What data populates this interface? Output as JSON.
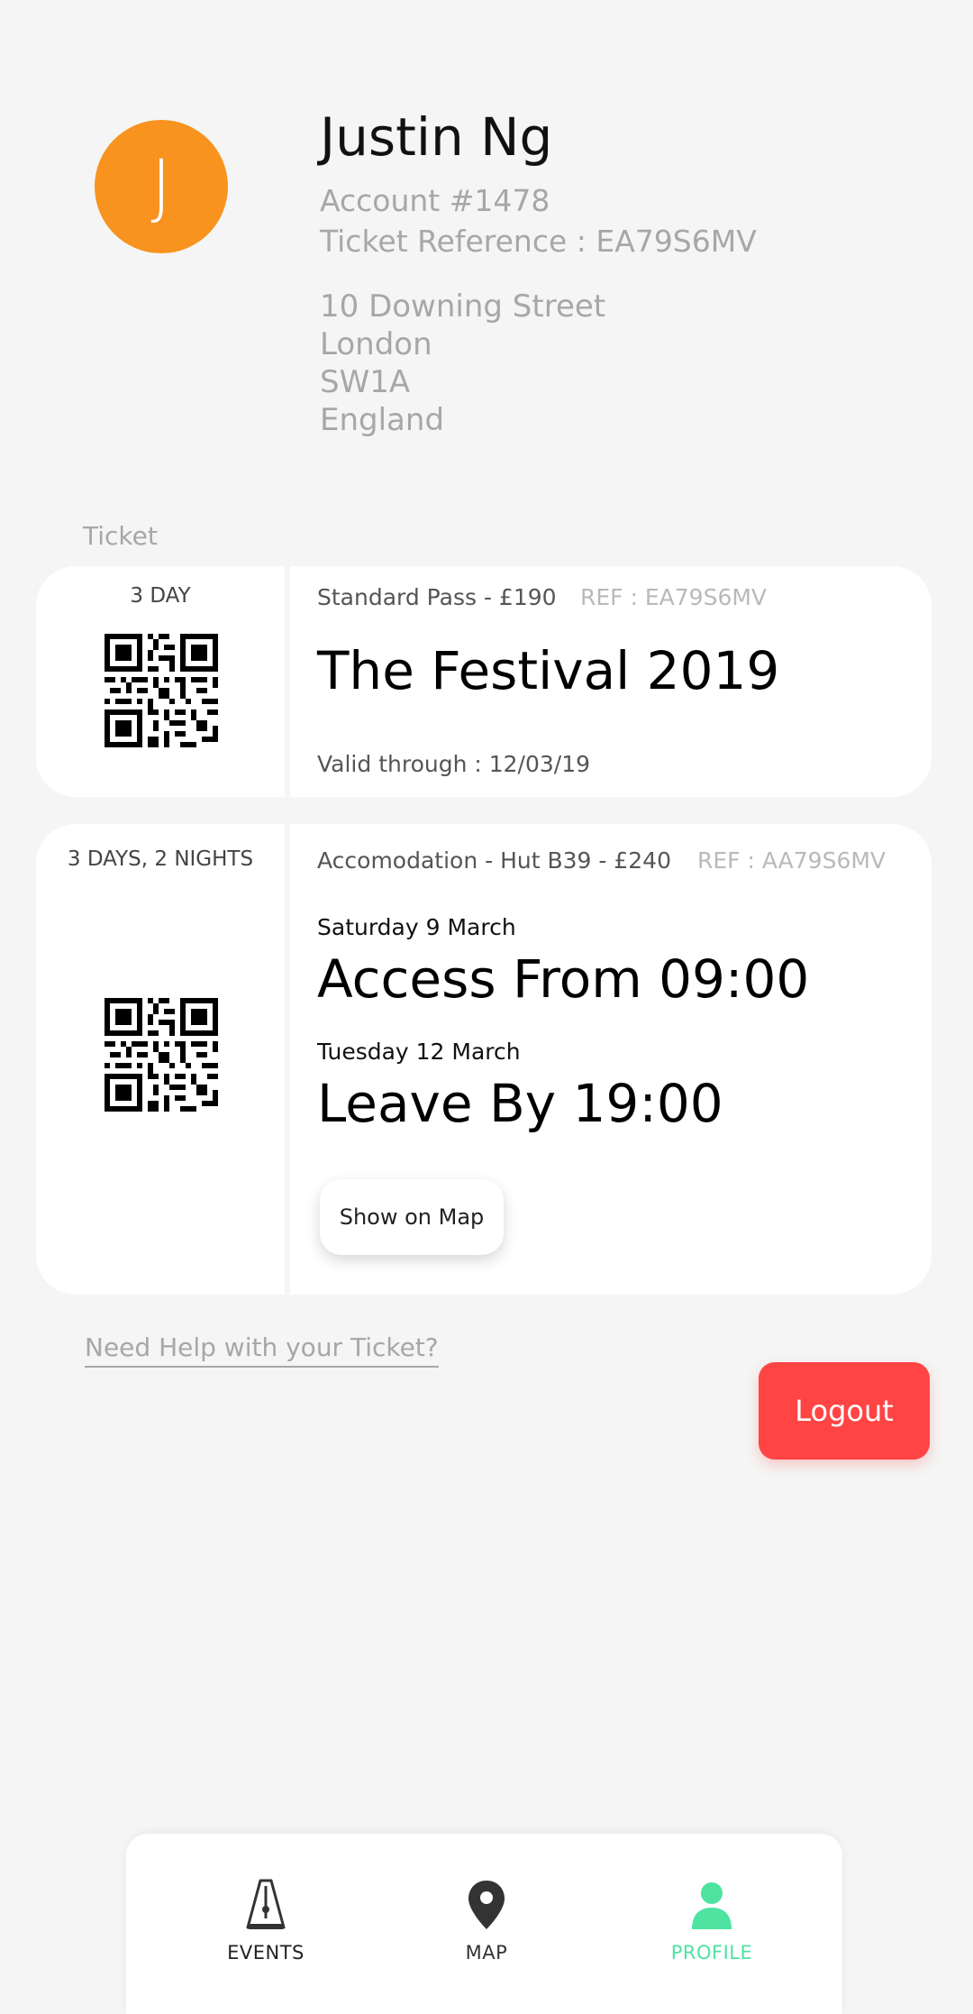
{
  "profile": {
    "avatar_initial": "J",
    "name": "Justin Ng",
    "account": "Account #1478",
    "ticket_reference": "Ticket Reference : EA79S6MV",
    "address": [
      "10 Downing Street",
      "London",
      "SW1A",
      "England"
    ]
  },
  "section_label": "Ticket",
  "tickets": [
    {
      "stub_title": "3 DAY",
      "pass": "Standard Pass - £190",
      "ref": "REF : EA79S6MV",
      "title": "The Festival 2019",
      "valid": "Valid through : 12/03/19"
    },
    {
      "stub_title": "3 DAYS, 2 NIGHTS",
      "pass": "Accomodation - Hut B39 - £240",
      "ref": "REF : AA79S6MV",
      "from_day": "Saturday 9 March",
      "from_time": "Access From 09:00",
      "to_day": "Tuesday 12 March",
      "to_time": "Leave By 19:00",
      "map_button": "Show on Map"
    }
  ],
  "help_link": "Need Help with your Ticket?",
  "logout_label": "Logout",
  "nav": {
    "items": [
      {
        "label": "EVENTS",
        "icon": "metronome-icon"
      },
      {
        "label": "MAP",
        "icon": "map-pin-icon"
      },
      {
        "label": "PROFILE",
        "icon": "person-icon"
      }
    ],
    "active": "PROFILE",
    "active_color": "#4ee3a0"
  },
  "colors": {
    "avatar": "#f7931e",
    "logout": "#ff4444",
    "background": "#f4f5f4"
  }
}
